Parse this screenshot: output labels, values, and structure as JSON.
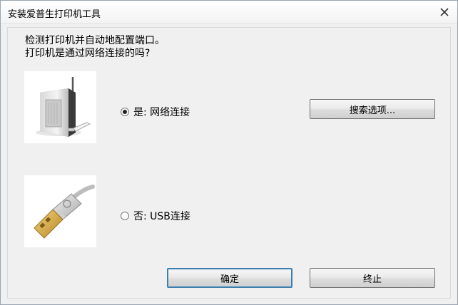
{
  "window": {
    "title": "安装爱普生打印机工具"
  },
  "message": {
    "line1": "检测打印机并自动地配置端口。",
    "line2": "打印机是通过网络连接的吗?"
  },
  "options": [
    {
      "label": "是: 网络连接",
      "selected": true,
      "icon": "network-printer-icon"
    },
    {
      "label": "否: USB连接",
      "selected": false,
      "icon": "usb-plug-icon"
    }
  ],
  "buttons": {
    "search": "搜索选项...",
    "ok": "确定",
    "stop": "终止"
  }
}
